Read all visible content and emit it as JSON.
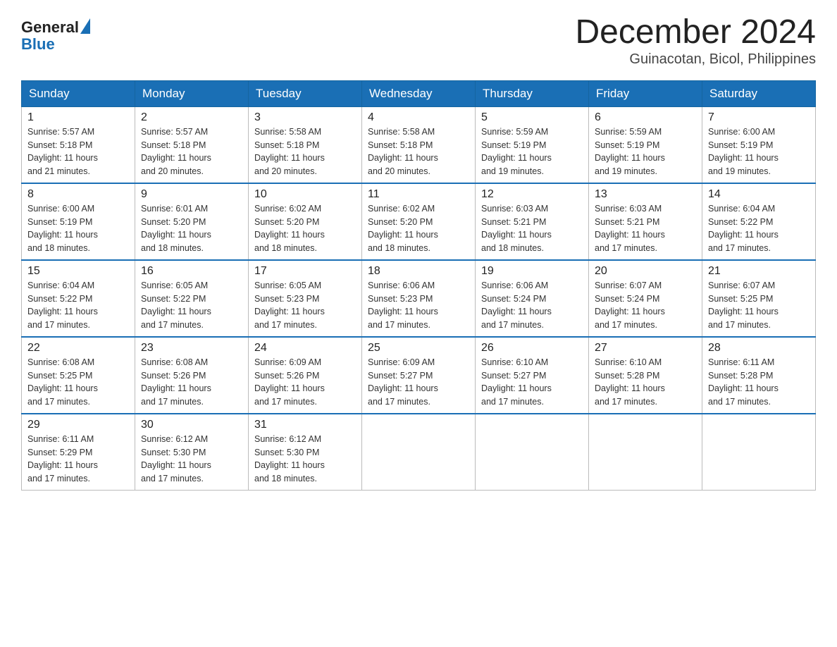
{
  "logo": {
    "line1": "General",
    "line2": "Blue"
  },
  "title": {
    "month": "December 2024",
    "location": "Guinacotan, Bicol, Philippines"
  },
  "weekdays": [
    "Sunday",
    "Monday",
    "Tuesday",
    "Wednesday",
    "Thursday",
    "Friday",
    "Saturday"
  ],
  "weeks": [
    [
      {
        "day": "1",
        "sunrise": "5:57 AM",
        "sunset": "5:18 PM",
        "daylight": "11 hours and 21 minutes."
      },
      {
        "day": "2",
        "sunrise": "5:57 AM",
        "sunset": "5:18 PM",
        "daylight": "11 hours and 20 minutes."
      },
      {
        "day": "3",
        "sunrise": "5:58 AM",
        "sunset": "5:18 PM",
        "daylight": "11 hours and 20 minutes."
      },
      {
        "day": "4",
        "sunrise": "5:58 AM",
        "sunset": "5:18 PM",
        "daylight": "11 hours and 20 minutes."
      },
      {
        "day": "5",
        "sunrise": "5:59 AM",
        "sunset": "5:19 PM",
        "daylight": "11 hours and 19 minutes."
      },
      {
        "day": "6",
        "sunrise": "5:59 AM",
        "sunset": "5:19 PM",
        "daylight": "11 hours and 19 minutes."
      },
      {
        "day": "7",
        "sunrise": "6:00 AM",
        "sunset": "5:19 PM",
        "daylight": "11 hours and 19 minutes."
      }
    ],
    [
      {
        "day": "8",
        "sunrise": "6:00 AM",
        "sunset": "5:19 PM",
        "daylight": "11 hours and 18 minutes."
      },
      {
        "day": "9",
        "sunrise": "6:01 AM",
        "sunset": "5:20 PM",
        "daylight": "11 hours and 18 minutes."
      },
      {
        "day": "10",
        "sunrise": "6:02 AM",
        "sunset": "5:20 PM",
        "daylight": "11 hours and 18 minutes."
      },
      {
        "day": "11",
        "sunrise": "6:02 AM",
        "sunset": "5:20 PM",
        "daylight": "11 hours and 18 minutes."
      },
      {
        "day": "12",
        "sunrise": "6:03 AM",
        "sunset": "5:21 PM",
        "daylight": "11 hours and 18 minutes."
      },
      {
        "day": "13",
        "sunrise": "6:03 AM",
        "sunset": "5:21 PM",
        "daylight": "11 hours and 17 minutes."
      },
      {
        "day": "14",
        "sunrise": "6:04 AM",
        "sunset": "5:22 PM",
        "daylight": "11 hours and 17 minutes."
      }
    ],
    [
      {
        "day": "15",
        "sunrise": "6:04 AM",
        "sunset": "5:22 PM",
        "daylight": "11 hours and 17 minutes."
      },
      {
        "day": "16",
        "sunrise": "6:05 AM",
        "sunset": "5:22 PM",
        "daylight": "11 hours and 17 minutes."
      },
      {
        "day": "17",
        "sunrise": "6:05 AM",
        "sunset": "5:23 PM",
        "daylight": "11 hours and 17 minutes."
      },
      {
        "day": "18",
        "sunrise": "6:06 AM",
        "sunset": "5:23 PM",
        "daylight": "11 hours and 17 minutes."
      },
      {
        "day": "19",
        "sunrise": "6:06 AM",
        "sunset": "5:24 PM",
        "daylight": "11 hours and 17 minutes."
      },
      {
        "day": "20",
        "sunrise": "6:07 AM",
        "sunset": "5:24 PM",
        "daylight": "11 hours and 17 minutes."
      },
      {
        "day": "21",
        "sunrise": "6:07 AM",
        "sunset": "5:25 PM",
        "daylight": "11 hours and 17 minutes."
      }
    ],
    [
      {
        "day": "22",
        "sunrise": "6:08 AM",
        "sunset": "5:25 PM",
        "daylight": "11 hours and 17 minutes."
      },
      {
        "day": "23",
        "sunrise": "6:08 AM",
        "sunset": "5:26 PM",
        "daylight": "11 hours and 17 minutes."
      },
      {
        "day": "24",
        "sunrise": "6:09 AM",
        "sunset": "5:26 PM",
        "daylight": "11 hours and 17 minutes."
      },
      {
        "day": "25",
        "sunrise": "6:09 AM",
        "sunset": "5:27 PM",
        "daylight": "11 hours and 17 minutes."
      },
      {
        "day": "26",
        "sunrise": "6:10 AM",
        "sunset": "5:27 PM",
        "daylight": "11 hours and 17 minutes."
      },
      {
        "day": "27",
        "sunrise": "6:10 AM",
        "sunset": "5:28 PM",
        "daylight": "11 hours and 17 minutes."
      },
      {
        "day": "28",
        "sunrise": "6:11 AM",
        "sunset": "5:28 PM",
        "daylight": "11 hours and 17 minutes."
      }
    ],
    [
      {
        "day": "29",
        "sunrise": "6:11 AM",
        "sunset": "5:29 PM",
        "daylight": "11 hours and 17 minutes."
      },
      {
        "day": "30",
        "sunrise": "6:12 AM",
        "sunset": "5:30 PM",
        "daylight": "11 hours and 17 minutes."
      },
      {
        "day": "31",
        "sunrise": "6:12 AM",
        "sunset": "5:30 PM",
        "daylight": "11 hours and 18 minutes."
      },
      null,
      null,
      null,
      null
    ]
  ],
  "labels": {
    "sunrise": "Sunrise:",
    "sunset": "Sunset:",
    "daylight": "Daylight:"
  }
}
